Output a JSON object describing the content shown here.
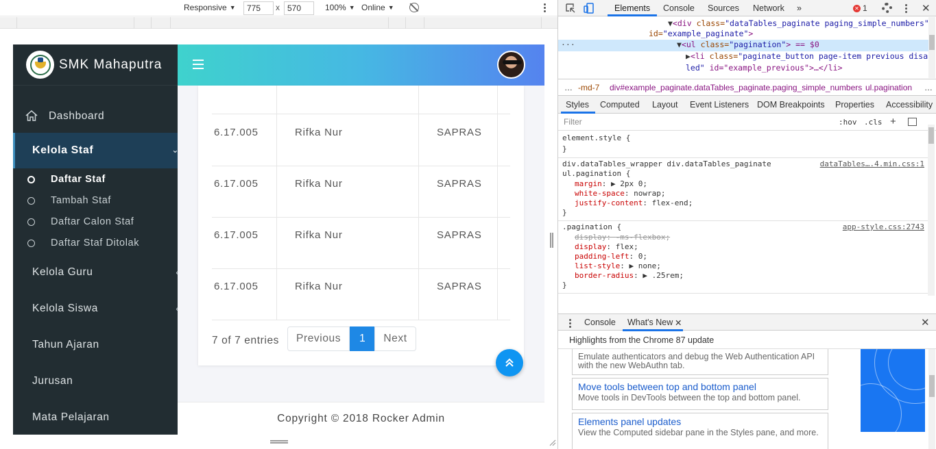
{
  "device_toolbar": {
    "device": "Responsive",
    "width": "775",
    "height": "570",
    "times": "x",
    "zoom": "100%",
    "throttle": "Online"
  },
  "app": {
    "brand": "SMK Mahaputra",
    "sidebar": {
      "dashboard": "Dashboard",
      "active_group": "Kelola Staf",
      "sub_items": [
        {
          "label": "Daftar Staf",
          "active": true
        },
        {
          "label": "Tambah Staf",
          "active": false
        },
        {
          "label": "Daftar Calon Staf",
          "active": false
        },
        {
          "label": "Daftar Staf Ditolak",
          "active": false
        }
      ],
      "groups": [
        {
          "label": "Kelola Guru"
        },
        {
          "label": "Kelola Siswa"
        },
        {
          "label": "Tahun Ajaran"
        },
        {
          "label": "Jurusan"
        },
        {
          "label": "Mata Pelajaran"
        }
      ]
    },
    "table": {
      "rows": [
        {
          "id": "6.17.005",
          "name": "Rifka Nur",
          "role": "SAPRAS"
        },
        {
          "id": "6.17.005",
          "name": "Rifka Nur",
          "role": "SAPRAS"
        },
        {
          "id": "6.17.005",
          "name": "Rifka Nur",
          "role": "SAPRAS"
        },
        {
          "id": "6.17.005",
          "name": "Rifka Nur",
          "role": "SAPRAS"
        }
      ],
      "info": "7 of 7 entries",
      "pagination": {
        "previous": "Previous",
        "current": "1",
        "next": "Next"
      }
    },
    "footer": "Copyright © 2018 Rocker Admin",
    "scroll_top_icon": "double-chevron-up-icon"
  },
  "devtools": {
    "tabs": [
      "Elements",
      "Console",
      "Sources",
      "Network"
    ],
    "more_tabs": "»",
    "error_count": "1",
    "dom_lines": [
      {
        "indent": "▼",
        "html_tag": "<div ",
        "attr": "class=",
        "value": "\"dataTables_paginate paging_simple_numbers\""
      },
      {
        "indent": "",
        "html_tag": "",
        "attr": "id=",
        "value": "\"example_paginate\"",
        "close": ">"
      },
      {
        "indent": "▼",
        "html_tag": "<ul ",
        "attr": "class=",
        "value": "\"pagination\"",
        "close": "> == $0"
      },
      {
        "indent": "▶",
        "html_tag": "<li ",
        "attr": "class=",
        "value": "\"paginate_button page-item previous disab"
      },
      {
        "indent": "",
        "html_tag": "",
        "attr": "",
        "value": "led\"",
        "close": " id=\"example_previous\">…</li>"
      }
    ],
    "breadcrumbs": [
      "…",
      "-md-7",
      "div#example_paginate.dataTables_paginate.paging_simple_numbers",
      "ul.pagination",
      "…"
    ],
    "style_tabs": [
      "Styles",
      "Computed",
      "Layout",
      "Event Listeners",
      "DOM Breakpoints",
      "Properties",
      "Accessibility"
    ],
    "filter_placeholder": "Filter",
    "filter_hov": ":hov",
    "filter_cls": ".cls",
    "rules": {
      "element_style": "element.style {",
      "close_brace": "}",
      "rule1_selector_a": "div.dataTables_wrapper div.dataTables_paginate",
      "rule1_selector_b": "ul.pagination {",
      "rule1_source": "dataTables….4.min.css:1",
      "rule1_props": [
        {
          "name": "margin",
          "value": "▶ 2px 0;"
        },
        {
          "name": "white-space",
          "value": "nowrap;"
        },
        {
          "name": "justify-content",
          "value": "flex-end;"
        }
      ],
      "rule2_selector": ".pagination {",
      "rule2_source": "app-style.css:2743",
      "rule2_props": [
        {
          "name": "display",
          "value": "-ms-flexbox;",
          "struck": true
        },
        {
          "name": "display",
          "value": "flex;",
          "struck": false
        },
        {
          "name": "padding-left",
          "value": "0;",
          "struck": false
        },
        {
          "name": "list-style",
          "value": "▶ none;",
          "struck": false
        },
        {
          "name": "border-radius",
          "value": "▶ .25rem;",
          "struck": false
        }
      ]
    },
    "drawer": {
      "tabs": [
        "Console",
        "What's New"
      ],
      "headline": "Highlights from the Chrome 87 update",
      "items": [
        {
          "title": "",
          "desc": "Emulate authenticators and debug the Web Authentication API with the new WebAuthn tab."
        },
        {
          "title": "Move tools between top and bottom panel",
          "desc": "Move tools in DevTools between the top and bottom panel."
        },
        {
          "title": "Elements panel updates",
          "desc": "View the Computed sidebar pane in the Styles pane, and more."
        }
      ]
    },
    "accent_color": "#1a73e8"
  }
}
